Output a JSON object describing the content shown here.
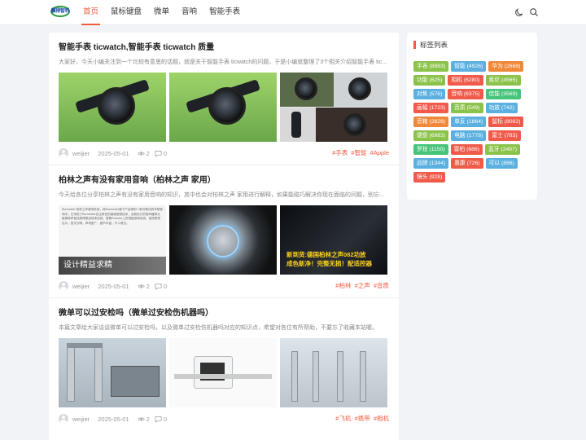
{
  "header": {
    "logo_text": "赢得智科",
    "nav": [
      "首页",
      "鼠标键盘",
      "微单",
      "音响",
      "智能手表"
    ],
    "active_index": 0,
    "icons": [
      "moon-icon",
      "search-icon"
    ]
  },
  "posts": [
    {
      "title": "智能手表 ticwatch,智能手表 ticwatch 质量",
      "excerpt": "大家好，今天小编关注到一个比较有意思的话题，就是关于智能手表 ticwatch的问题，于是小编就整理了3个相关介绍智能手表 ticwatch的解答，让我们一起看看吧。",
      "author": "weijier",
      "date": "2025-05-01",
      "views": "2",
      "comments": "0",
      "tags": [
        "#手表",
        "#智能",
        "#Apple"
      ]
    },
    {
      "title": "柏林之声有没有家用音响（柏林之声 家用）",
      "excerpt": "今天给各位分享柏林之声有没有家用音响的知识，其中也会对柏林之声 家用进行解释，如果能碰巧解决你现在面临的问题，别忘了关注本站，现在开始吧！",
      "author": "weijier",
      "date": "2025-05-01",
      "views": "2",
      "comments": "0",
      "tags": [
        "#柏林",
        "#之声",
        "#音质"
      ],
      "thumb_text": {
        "tech_band": "设计精益求精",
        "promo_line1": "新到货:德国柏林之声082功放",
        "promo_line2": "成色新净！完整无损！配适控器",
        "tech_body": "Burmester 柏林之声音响系统，将Burmester旗下产品带到一款可移动的车载音响中。它采用了Burmester自主研发的高端音频技术，全新设计的扬声器单元能够将声音还原得更加纯净自然。搭载Porsche上的顶级音响系统，音质表现出众，层次分明，声场宽广，细节丰富，令人难忘。"
      }
    },
    {
      "title": "微单可以过安检吗（微单过安检伤机器吗）",
      "excerpt": "本篇文章给大家谈谈微单可以过安检吗，以及微单过安检伤机器吗对应的知识点，希望对各位有所帮助，不要忘了收藏本站喔。",
      "author": "weijier",
      "date": "2025-05-01",
      "views": "2",
      "comments": "0",
      "tags": [
        "#飞机",
        "#携带",
        "#相机"
      ]
    }
  ],
  "sidebar": {
    "title": "标签列表",
    "tags": [
      {
        "label": "手表 (8983)",
        "color": "#8bc34a"
      },
      {
        "label": "智能 (4926)",
        "color": "#5bb0e0"
      },
      {
        "label": "华为 (2668)",
        "color": "#f0883a"
      },
      {
        "label": "功能 (625)",
        "color": "#8bc34a"
      },
      {
        "label": "相机 (6280)",
        "color": "#f05a4a"
      },
      {
        "label": "索尼 (4565)",
        "color": "#8bc34a"
      },
      {
        "label": "对焦 (576)",
        "color": "#5bb0e0"
      },
      {
        "label": "音响 (6375)",
        "color": "#f05a4a"
      },
      {
        "label": "佳能 (3569)",
        "color": "#46c47a"
      },
      {
        "label": "画幅 (1723)",
        "color": "#f05a4a"
      },
      {
        "label": "音质 (549)",
        "color": "#8bc34a"
      },
      {
        "label": "功放 (742)",
        "color": "#5bb0e0"
      },
      {
        "label": "音箱 (2828)",
        "color": "#f0883a"
      },
      {
        "label": "单反 (1864)",
        "color": "#5bb0e0"
      },
      {
        "label": "鼠标 (8082)",
        "color": "#f05a4a"
      },
      {
        "label": "键盘 (6983)",
        "color": "#8bc34a"
      },
      {
        "label": "电脑 (1778)",
        "color": "#5bb0e0"
      },
      {
        "label": "富士 (783)",
        "color": "#f05a4a"
      },
      {
        "label": "罗技 (1150)",
        "color": "#46c47a"
      },
      {
        "label": "雷柏 (686)",
        "color": "#f05a4a"
      },
      {
        "label": "蓝牙 (2487)",
        "color": "#8bc34a"
      },
      {
        "label": "品牌 (1344)",
        "color": "#5bb0e0"
      },
      {
        "label": "惠康 (726)",
        "color": "#f05a4a"
      },
      {
        "label": "可以 (886)",
        "color": "#5bb0e0"
      },
      {
        "label": "镜头 (928)",
        "color": "#f05a4a"
      }
    ]
  },
  "colors": {
    "accent": "#f35a3f",
    "background": "#f2f3f7"
  }
}
